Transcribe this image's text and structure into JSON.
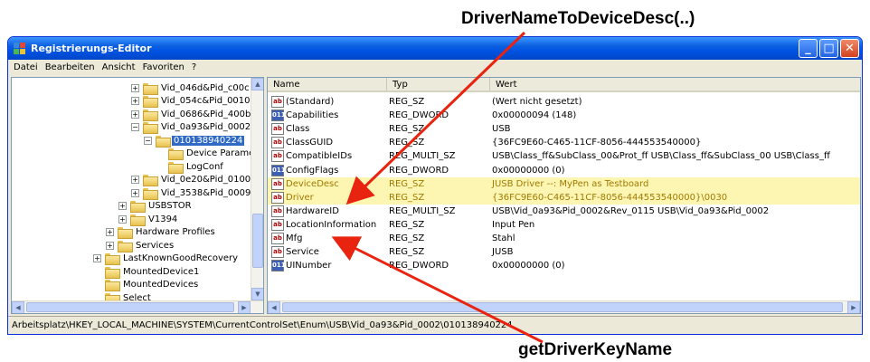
{
  "annotations": {
    "top_label": "DriverNameToDeviceDesc(..)",
    "bottom_label": "getDriverKeyName",
    "arrow_color": "#e8230f"
  },
  "window": {
    "title": "Registrierungs-Editor",
    "buttons": {
      "minimize": "_",
      "maximize": "□",
      "close": "✕"
    }
  },
  "menu": [
    "Datei",
    "Bearbeiten",
    "Ansicht",
    "Favoriten",
    "?"
  ],
  "tree": [
    {
      "label": "Vid_046d&Pid_c00c",
      "expander": "+",
      "level": 2
    },
    {
      "label": "Vid_054c&Pid_0010",
      "expander": "+",
      "level": 2
    },
    {
      "label": "Vid_0686&Pid_400b",
      "expander": "+",
      "level": 2
    },
    {
      "label": "Vid_0a93&Pid_0002",
      "expander": "−",
      "level": 2
    },
    {
      "label": "010138940224",
      "expander": "−",
      "level": 3,
      "selected": true
    },
    {
      "label": "Device Parameters",
      "expander": "",
      "level": 4
    },
    {
      "label": "LogConf",
      "expander": "",
      "level": 4
    },
    {
      "label": "Vid_0e20&Pid_0100",
      "expander": "+",
      "level": 2
    },
    {
      "label": "Vid_3538&Pid_0009",
      "expander": "+",
      "level": 2
    },
    {
      "label": "USBSTOR",
      "expander": "+",
      "level": 1
    },
    {
      "label": "V1394",
      "expander": "+",
      "level": 1
    },
    {
      "label": "Hardware Profiles",
      "expander": "+",
      "level": 0
    },
    {
      "label": "Services",
      "expander": "+",
      "level": 0
    },
    {
      "label": "LastKnownGoodRecovery",
      "expander": "+",
      "level": -1
    },
    {
      "label": "MountedDevice1",
      "expander": "",
      "level": -1
    },
    {
      "label": "MountedDevices",
      "expander": "",
      "level": -1
    },
    {
      "label": "Select",
      "expander": "",
      "level": -1
    }
  ],
  "columns": {
    "name": "Name",
    "type": "Typ",
    "data": "Wert"
  },
  "values": [
    {
      "name": "(Standard)",
      "type": "REG_SZ",
      "data": "(Wert nicht gesetzt)",
      "icon": "ab",
      "kind": "str"
    },
    {
      "name": "Capabilities",
      "type": "REG_DWORD",
      "data": "0x00000094 (148)",
      "icon": "011",
      "kind": "bin"
    },
    {
      "name": "Class",
      "type": "REG_SZ",
      "data": "USB",
      "icon": "ab",
      "kind": "str"
    },
    {
      "name": "ClassGUID",
      "type": "REG_SZ",
      "data": "{36FC9E60-C465-11CF-8056-444553540000}",
      "icon": "ab",
      "kind": "str"
    },
    {
      "name": "CompatibleIDs",
      "type": "REG_MULTI_SZ",
      "data": "USB\\Class_ff&SubClass_00&Prot_ff USB\\Class_ff&SubClass_00 USB\\Class_ff",
      "icon": "ab",
      "kind": "str"
    },
    {
      "name": "ConfigFlags",
      "type": "REG_DWORD",
      "data": "0x00000000 (0)",
      "icon": "011",
      "kind": "bin"
    },
    {
      "name": "DeviceDesc",
      "type": "REG_SZ",
      "data": "JUSB Driver --: MyPen as Testboard",
      "icon": "ab",
      "kind": "str",
      "highlight": true
    },
    {
      "name": "Driver",
      "type": "REG_SZ",
      "data": "{36FC9E60-C465-11CF-8056-444553540000}\\0030",
      "icon": "ab",
      "kind": "str",
      "highlight": true
    },
    {
      "name": "HardwareID",
      "type": "REG_MULTI_SZ",
      "data": "USB\\Vid_0a93&Pid_0002&Rev_0115 USB\\Vid_0a93&Pid_0002",
      "icon": "ab",
      "kind": "str"
    },
    {
      "name": "LocationInformation",
      "type": "REG_SZ",
      "data": "Input Pen",
      "icon": "ab",
      "kind": "str"
    },
    {
      "name": "Mfg",
      "type": "REG_SZ",
      "data": "Stahl",
      "icon": "ab",
      "kind": "str"
    },
    {
      "name": "Service",
      "type": "REG_SZ",
      "data": "JUSB",
      "icon": "ab",
      "kind": "str"
    },
    {
      "name": "UINumber",
      "type": "REG_DWORD",
      "data": "0x00000000 (0)",
      "icon": "011",
      "kind": "bin"
    }
  ],
  "statusbar": "Arbeitsplatz\\HKEY_LOCAL_MACHINE\\SYSTEM\\CurrentControlSet\\Enum\\USB\\Vid_0a93&Pid_0002\\010138940224"
}
